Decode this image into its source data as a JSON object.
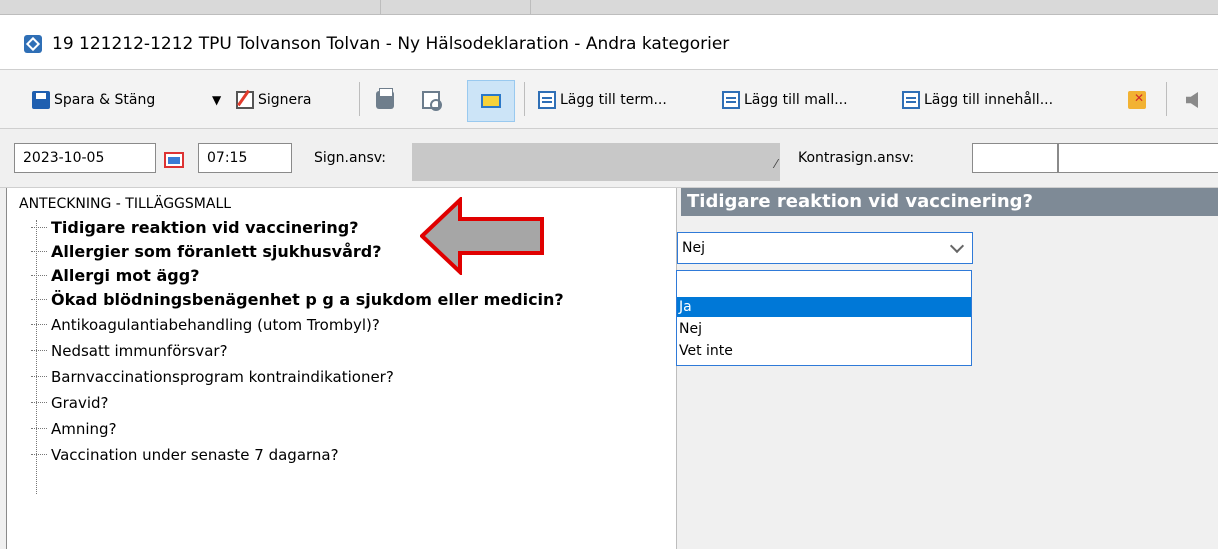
{
  "window": {
    "title": "19 121212-1212 TPU Tolvanson Tolvan - Ny Hälsodeklaration - Andra kategorier",
    "icon": "app-diamond-icon"
  },
  "toolbar": {
    "save_close": "Spara & Stäng",
    "sign": "Signera",
    "add_term": "Lägg till term...",
    "add_template": "Lägg till mall...",
    "add_content": "Lägg till innehåll..."
  },
  "header_row": {
    "date": "2023-10-05",
    "time": "07:15",
    "sign_label": "Sign.ansv:",
    "countersign_label": "Kontrasign.ansv:"
  },
  "tree": {
    "root": "ANTECKNING - TILLÄGGSMALL",
    "items": [
      {
        "label": "Tidigare reaktion vid vaccinering?",
        "bold": true
      },
      {
        "label": "Allergier som föranlett sjukhusvård?",
        "bold": true
      },
      {
        "label": "Allergi mot ägg?",
        "bold": true
      },
      {
        "label": "Ökad blödningsbenägenhet p g a sjukdom eller medicin?",
        "bold": true
      },
      {
        "label": "Antikoagulantiabehandling (utom Trombyl)?",
        "bold": false
      },
      {
        "label": "Nedsatt immunförsvar?",
        "bold": false
      },
      {
        "label": "Barnvaccinationsprogram kontraindikationer?",
        "bold": false
      },
      {
        "label": "Gravid?",
        "bold": false
      },
      {
        "label": "Amning?",
        "bold": false
      },
      {
        "label": "Vaccination under senaste 7 dagarna?",
        "bold": false
      }
    ]
  },
  "field": {
    "title": "Tidigare reaktion vid vaccinering?",
    "selected_value": "Nej",
    "options": [
      "",
      "Ja",
      "Nej",
      "Vet inte"
    ],
    "highlighted_option": "Ja"
  },
  "colors": {
    "field_header_bg": "#7e8a96",
    "selection": "#0078d7",
    "annotation_arrow_border": "#e00000",
    "annotation_arrow_fill": "#a6a6a6"
  }
}
